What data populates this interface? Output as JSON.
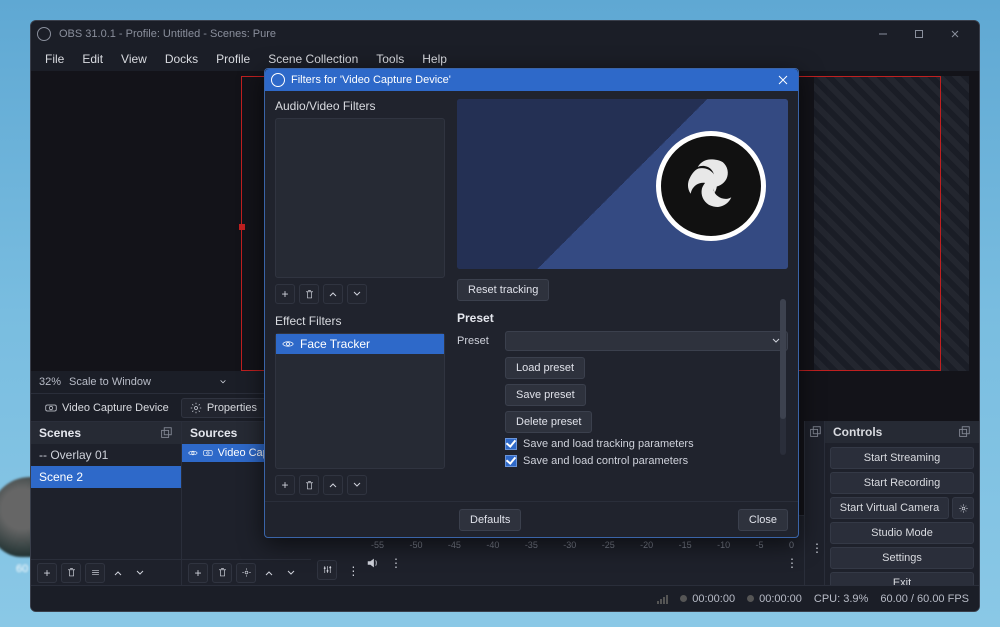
{
  "title": "OBS 31.0.1 - Profile: Untitled - Scenes: Pure",
  "menus": [
    "File",
    "Edit",
    "View",
    "Docks",
    "Profile",
    "Scene Collection",
    "Tools",
    "Help"
  ],
  "zoom": {
    "percent": "32%",
    "mode": "Scale to Window"
  },
  "ctx": {
    "source_name": "Video Capture Device",
    "properties": "Properties"
  },
  "panels": {
    "scenes": {
      "title": "Scenes",
      "items": [
        "-- Overlay 01",
        "Scene 2"
      ],
      "selected": 1
    },
    "sources": {
      "title": "Sources",
      "items": [
        "Video Capture Device"
      ],
      "selected": 0
    },
    "controls": {
      "title": "Controls",
      "buttons": [
        "Start Streaming",
        "Start Recording",
        "Start Virtual Camera",
        "Studio Mode",
        "Settings",
        "Exit"
      ]
    }
  },
  "mixer": {
    "db_labels": [
      "-55",
      "-50",
      "-45",
      "-40",
      "-35",
      "-30",
      "-25",
      "-20",
      "-15",
      "-10",
      "-5",
      "0"
    ]
  },
  "status": {
    "time1": "00:00:00",
    "time2": "00:00:00",
    "cpu": "CPU: 3.9%",
    "fps": "60.00 / 60.00 FPS"
  },
  "dialog": {
    "title": "Filters for 'Video Capture Device'",
    "av_label": "Audio/Video Filters",
    "eff_label": "Effect Filters",
    "effect_items": [
      "Face Tracker"
    ],
    "reset": "Reset tracking",
    "preset_h": "Preset",
    "preset_label": "Preset",
    "load": "Load preset",
    "save": "Save preset",
    "delete": "Delete preset",
    "chk1": "Save and load tracking parameters",
    "chk2": "Save and load control parameters",
    "defaults": "Defaults",
    "close": "Close"
  }
}
